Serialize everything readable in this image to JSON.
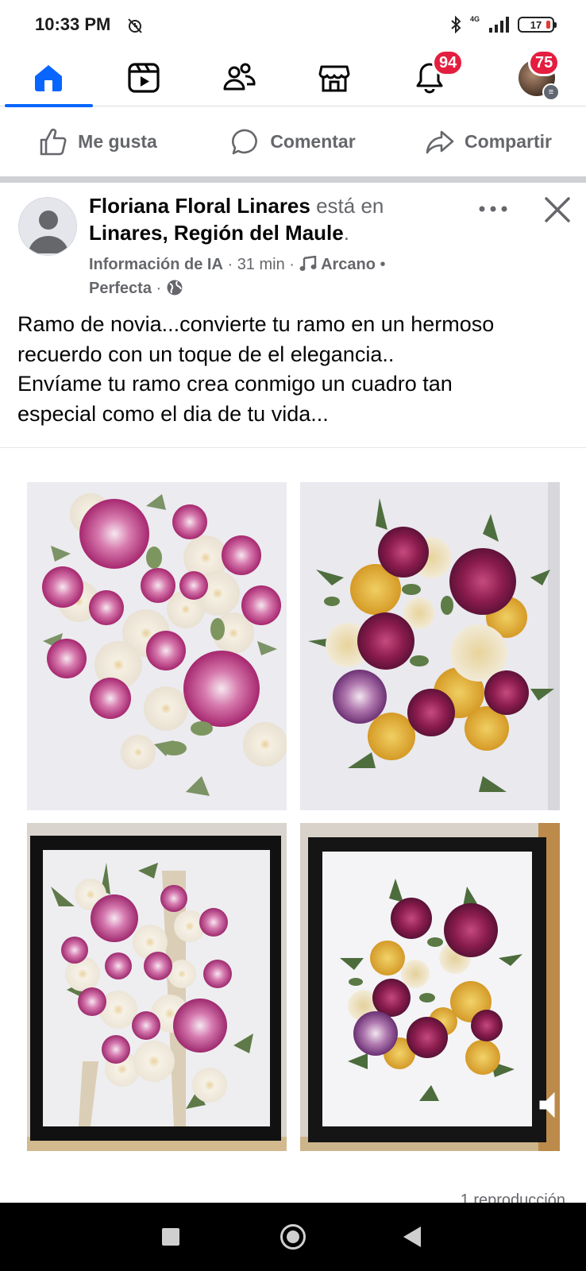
{
  "status_bar": {
    "time": "10:33 PM",
    "network": "4G",
    "battery": "17"
  },
  "nav": {
    "items": [
      {
        "name": "home",
        "active": true
      },
      {
        "name": "video"
      },
      {
        "name": "friends"
      },
      {
        "name": "marketplace"
      },
      {
        "name": "notifications",
        "badge": "94"
      },
      {
        "name": "profile-menu",
        "badge": "75"
      }
    ],
    "accent": "#0866ff",
    "badge_color": "#e41e3f"
  },
  "actions": {
    "like": "Me gusta",
    "comment": "Comentar",
    "share": "Compartir"
  },
  "post": {
    "author": "Floriana Floral Linares",
    "verb": "está en",
    "location": "Linares, Región del Maule",
    "location_suffix": ".",
    "ai_info": "Información de IA",
    "time": "31 min",
    "music_artist": "Arcano",
    "music_song": "Perfecta",
    "text_lines": [
      "Ramo de novia...convierte tu ramo en un hermoso",
      "recuerdo con un toque de el elegancia..",
      "Envíame tu ramo crea conmigo un cuadro tan",
      "especial como el dia de tu vida..."
    ],
    "photos": [
      {
        "description": "pink-white-pressed-roses"
      },
      {
        "description": "purple-yellow-pressed-roses"
      },
      {
        "description": "framed-pink-white-roses"
      },
      {
        "description": "framed-purple-yellow-roses"
      }
    ],
    "footer": "1 reproducción"
  }
}
